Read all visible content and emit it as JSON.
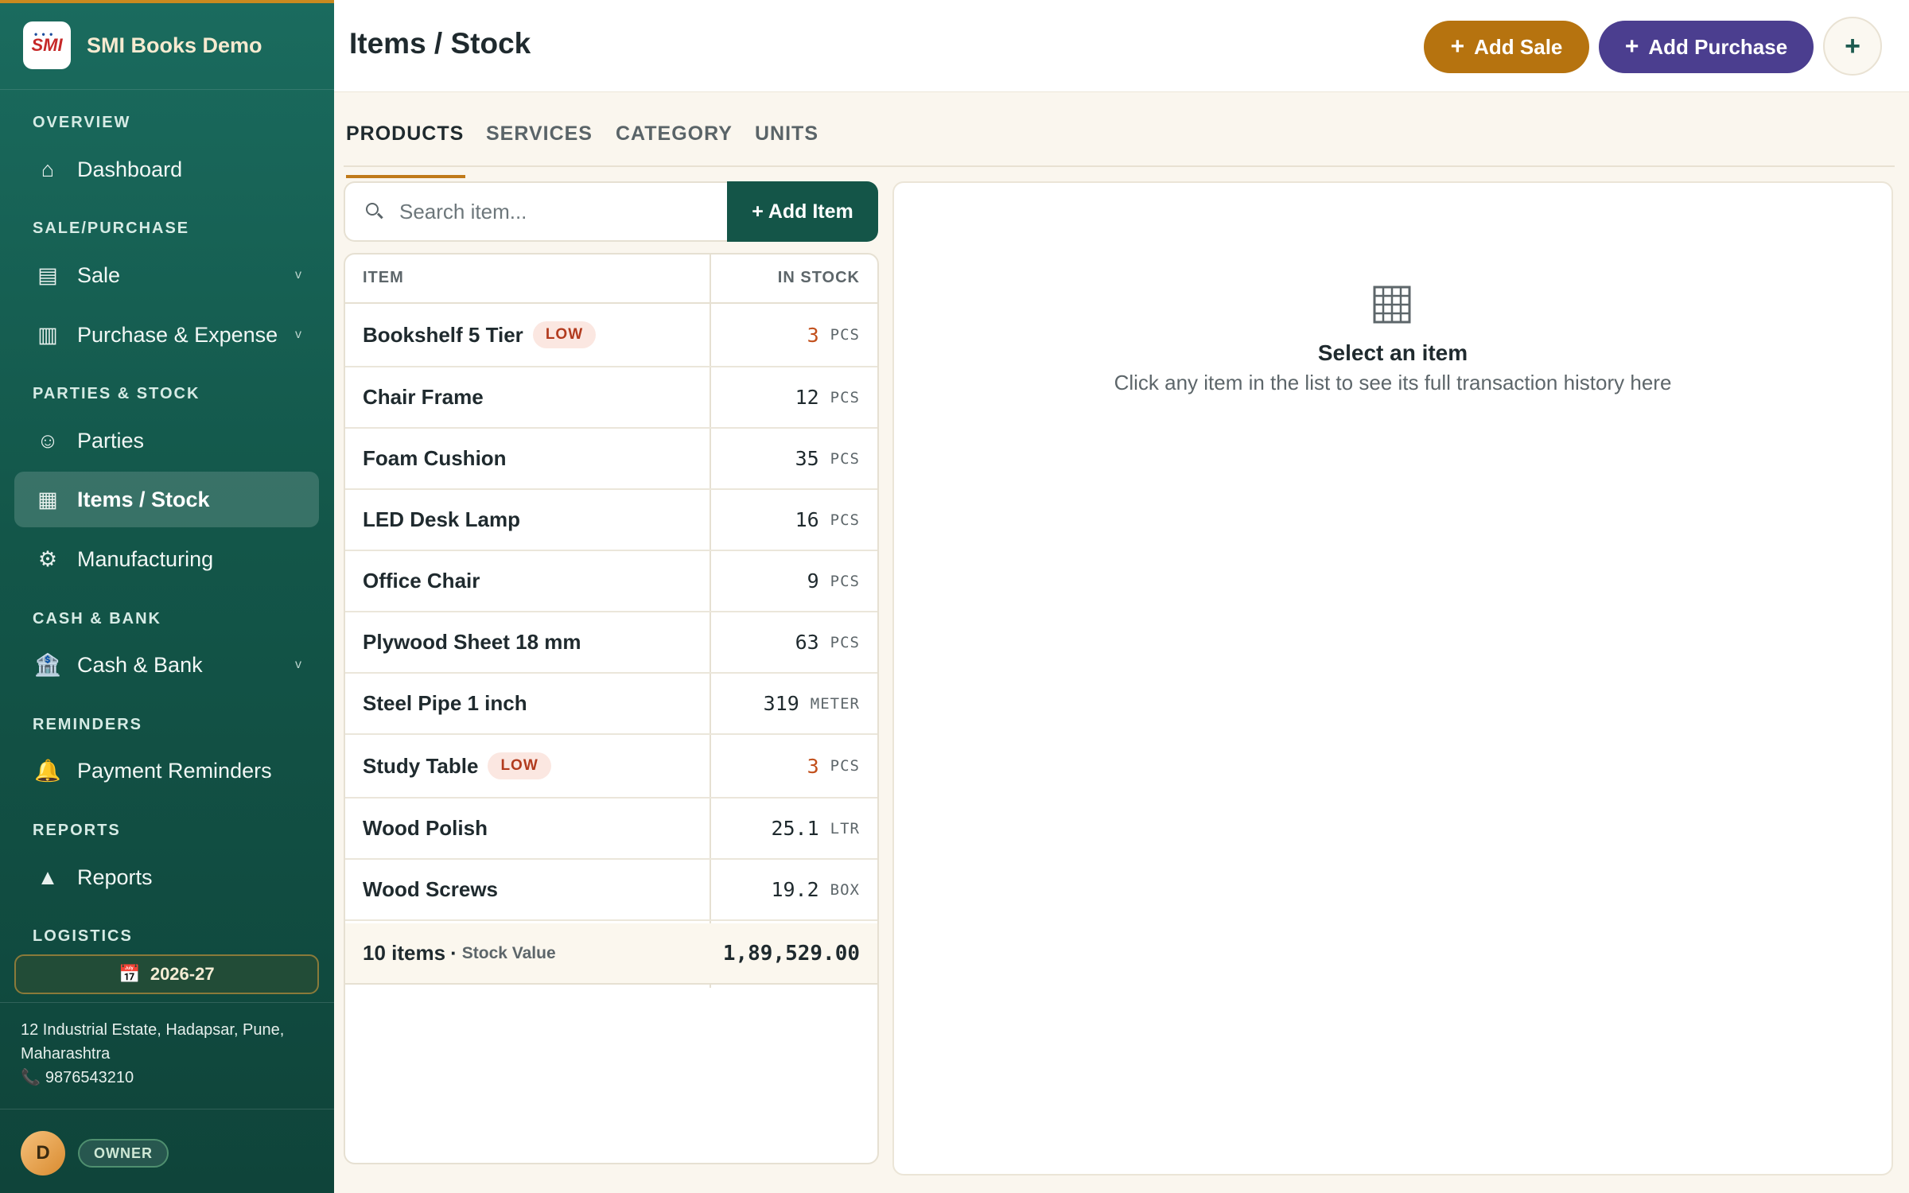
{
  "brand": {
    "name": "SMI Books Demo",
    "logo_text": "SMI"
  },
  "sidebar": {
    "sections": {
      "overview": "OVERVIEW",
      "sale_purchase": "SALE/PURCHASE",
      "parties_stock": "PARTIES & STOCK",
      "cash_bank": "CASH & BANK",
      "reminders": "REMINDERS",
      "reports": "REPORTS",
      "logistics": "LOGISTICS"
    },
    "items": {
      "dashboard": {
        "label": "Dashboard",
        "icon": "home-icon"
      },
      "sale": {
        "label": "Sale",
        "icon": "receipt-icon",
        "chevron": "v"
      },
      "purchase": {
        "label": "Purchase & Expense",
        "icon": "cart-icon",
        "chevron": "v"
      },
      "parties": {
        "label": "Parties",
        "icon": "smiley-icon"
      },
      "items_stock": {
        "label": "Items / Stock",
        "icon": "grid-icon",
        "active": true
      },
      "manufacturing": {
        "label": "Manufacturing",
        "icon": "gear-icon"
      },
      "cash_bank": {
        "label": "Cash & Bank",
        "icon": "bank-icon",
        "chevron": "v"
      },
      "payment_reminders": {
        "label": "Payment Reminders",
        "icon": "bell-icon"
      },
      "reports": {
        "label": "Reports",
        "icon": "triangle-icon"
      }
    },
    "fiscal_year": "2026-27",
    "address": "12 Industrial Estate, Hadapsar, Pune, Maharashtra",
    "phone": "9876543210",
    "user": {
      "initial": "D",
      "role": "OWNER"
    }
  },
  "header": {
    "title": "Items / Stock",
    "add_sale_label": "Add Sale",
    "add_purchase_label": "Add Purchase",
    "more_label": "+"
  },
  "tabs": [
    "PRODUCTS",
    "SERVICES",
    "CATEGORY",
    "UNITS"
  ],
  "active_tab": "PRODUCTS",
  "search": {
    "placeholder": "Search item...",
    "value": ""
  },
  "add_item_label": "+ Add Item",
  "table": {
    "columns": [
      "ITEM",
      "IN STOCK"
    ],
    "rows": [
      {
        "name": "Bookshelf 5 Tier",
        "badge": "LOW",
        "qty": "3",
        "unit": "PCS"
      },
      {
        "name": "Chair Frame",
        "badge": "",
        "qty": "12",
        "unit": "PCS"
      },
      {
        "name": "Foam Cushion",
        "badge": "",
        "qty": "35",
        "unit": "PCS"
      },
      {
        "name": "LED Desk Lamp",
        "badge": "",
        "qty": "16",
        "unit": "PCS"
      },
      {
        "name": "Office Chair",
        "badge": "",
        "qty": "9",
        "unit": "PCS"
      },
      {
        "name": "Plywood Sheet 18 mm",
        "badge": "",
        "qty": "63",
        "unit": "PCS"
      },
      {
        "name": "Steel Pipe 1 inch",
        "badge": "",
        "qty": "319",
        "unit": "METER"
      },
      {
        "name": "Study Table",
        "badge": "LOW",
        "qty": "3",
        "unit": "PCS"
      },
      {
        "name": "Wood Polish",
        "badge": "",
        "qty": "25.1",
        "unit": "LTR"
      },
      {
        "name": "Wood Screws",
        "badge": "",
        "qty": "19.2",
        "unit": "BOX"
      }
    ],
    "footer": {
      "count_label": "10 items",
      "dot": "·",
      "sub_label": "Stock Value",
      "value": "1,89,529.00"
    }
  },
  "detail": {
    "icon": "building-icon",
    "title": "Select an item",
    "subtitle": "Click any item in the list to see its full transaction history here"
  },
  "colors": {
    "sidebar_top": "#1a6b5e",
    "sidebar_bottom": "#0f443a",
    "accent_gold": "#c07a1a",
    "sale_button": "#b6730f",
    "purchase_button": "#4b3e8f",
    "add_item_button": "#145548",
    "low_text": "#c2501c"
  }
}
